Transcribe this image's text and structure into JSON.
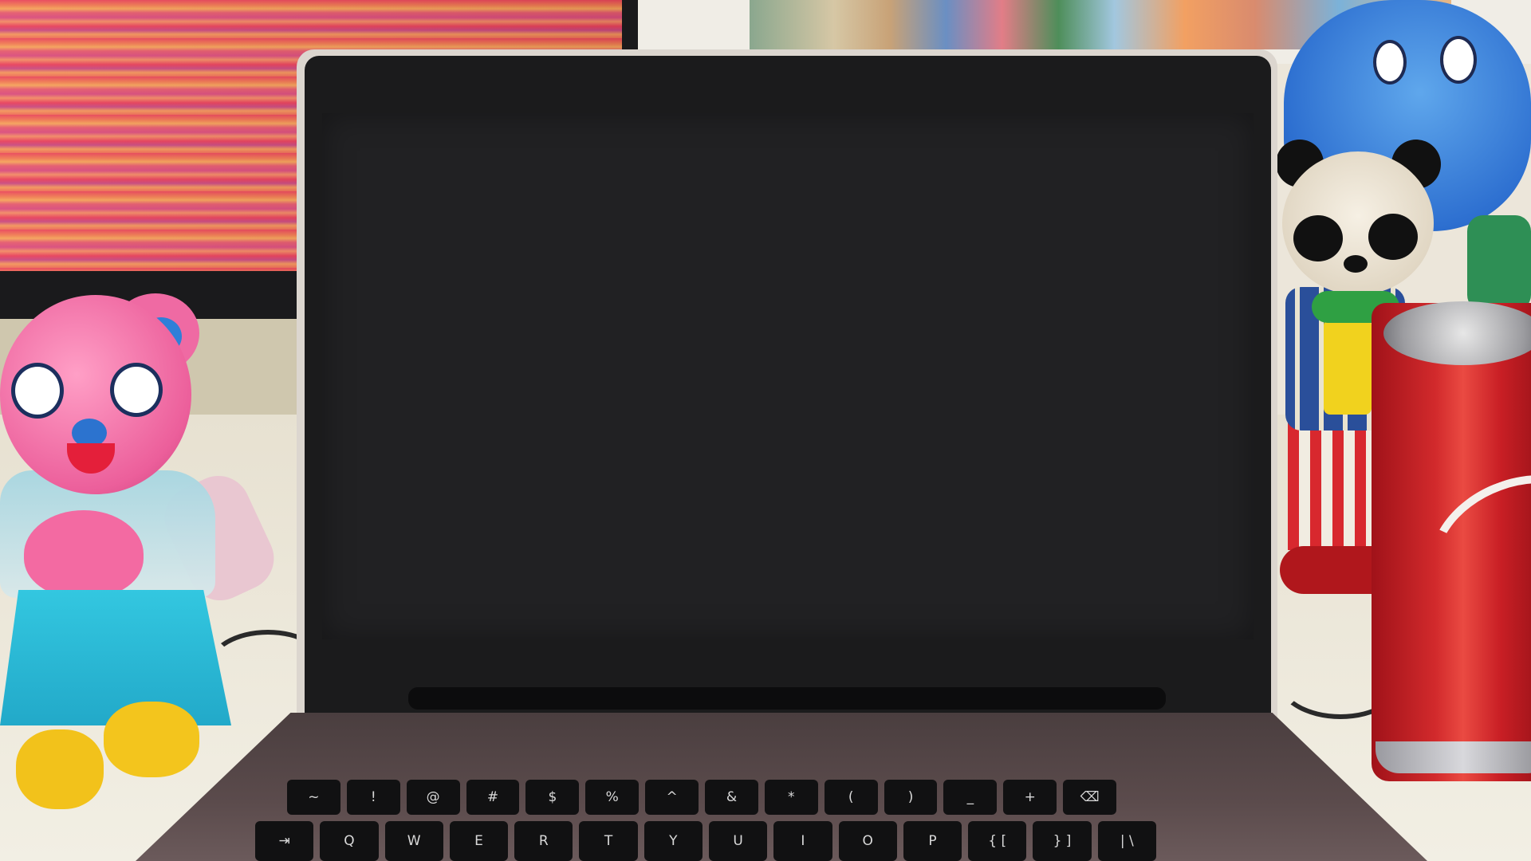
{
  "scene": {
    "description_tags": [
      "laptop",
      "pink-bear-figure",
      "panda-figure",
      "blue-elephant-figure",
      "soda-can",
      "striped-monitor"
    ],
    "colors": {
      "laptop_screen": "#212123",
      "laptop_bezel": "#1b1b1c",
      "desk": "#ece6da",
      "soda_can_red": "#d22a2c",
      "bear_pink": "#ec5f9b",
      "elephant_blue": "#2d6fd0"
    }
  },
  "keyboard": {
    "row1": [
      "~",
      "!",
      "@",
      "#",
      "$",
      "%",
      "^",
      "&",
      "*",
      "(",
      ")",
      "_",
      "+",
      "⌫"
    ],
    "row2": [
      "⇥",
      "Q",
      "W",
      "E",
      "R",
      "T",
      "Y",
      "U",
      "I",
      "O",
      "P",
      "{ [",
      "} ]",
      "| \\"
    ]
  }
}
